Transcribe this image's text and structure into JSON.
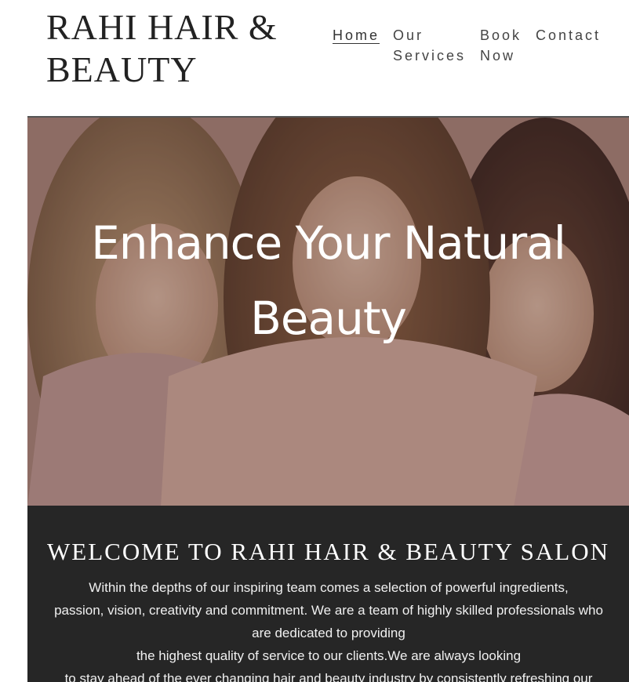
{
  "header": {
    "logo_line1": "RAHI HAIR &",
    "logo_line2": "BEAUTY"
  },
  "nav": {
    "home": "Home",
    "services_line1": "Our",
    "services_line2": "Services",
    "book_line1": "Book",
    "book_line2": "Now",
    "contact": "Contact"
  },
  "hero": {
    "title_line1": "Enhance Your Natural",
    "title_line2": "Beauty"
  },
  "welcome": {
    "title": "WELCOME TO RAHI HAIR & BEAUTY SALON",
    "lines": [
      "Within the depths of our inspiring team comes a selection of powerful ingredients,",
      "passion, vision, creativity and commitment. We are a team of highly skilled professionals who",
      "are dedicated to providing",
      "the highest quality of service to our clients.We are always looking",
      "to stay ahead of the ever changing hair and beauty industry by consistently refreshing our"
    ]
  },
  "colors": {
    "welcome_bg": "#262626",
    "text_dark": "#222222"
  }
}
